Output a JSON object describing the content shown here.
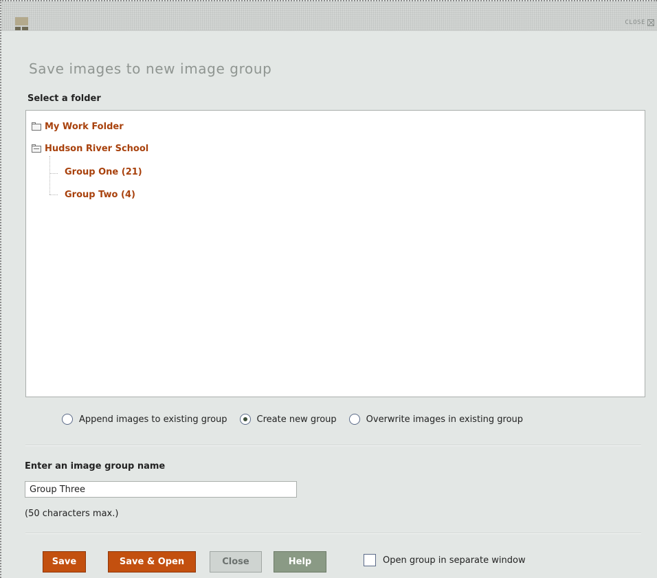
{
  "titlebar": {
    "close_label": "CLOSE"
  },
  "dialog": {
    "title": "Save images to new image group",
    "folder_label": "Select a folder"
  },
  "tree": {
    "folders": [
      {
        "label": "My Work Folder",
        "icon": "folder-closed-icon"
      },
      {
        "label": "Hudson River School",
        "icon": "folder-open-icon",
        "groups": [
          {
            "label": "Group One (21)"
          },
          {
            "label": "Group Two (4)"
          }
        ]
      }
    ]
  },
  "mode": {
    "options": [
      {
        "label": "Append images to existing group",
        "checked": false
      },
      {
        "label": "Create new group",
        "checked": true
      },
      {
        "label": "Overwrite images in existing group",
        "checked": false
      }
    ]
  },
  "name_field": {
    "label": "Enter an image group name",
    "value": "Group Three",
    "hint": "(50 characters max.)"
  },
  "buttons": {
    "save": "Save",
    "save_open": "Save & Open",
    "close": "Close",
    "help": "Help"
  },
  "separate_window": {
    "label": "Open group in separate window",
    "checked": false
  },
  "colors": {
    "accent": "#c3500f",
    "link": "#a8410c",
    "background": "#e3e7e5"
  }
}
